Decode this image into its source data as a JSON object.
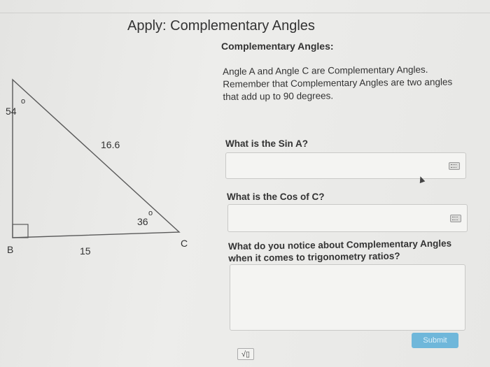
{
  "page": {
    "title": "Apply: Complementary Angles"
  },
  "diagram": {
    "vertex_b": "B",
    "vertex_c": "C",
    "angle_a": "54",
    "angle_c": "36",
    "side_ab_label": "15",
    "side_hyp_label": "16.6",
    "degree_symbol": "o"
  },
  "content": {
    "heading": "Complementary Angles:",
    "intro": "Angle A and Angle C are Complementary Angles. Remember that Complementary Angles are two angles that add up to 90 degrees."
  },
  "questions": [
    {
      "label": "What is the Sin A?",
      "value": ""
    },
    {
      "label": "What is the Cos of C?",
      "value": ""
    },
    {
      "label": "What do you notice about Complementary Angles when it comes to trigonometry ratios?",
      "value": ""
    }
  ],
  "buttons": {
    "submit_label": "Submit",
    "sqrt_label": "√▯"
  },
  "icons": {
    "keyboard": "keyboard-icon",
    "cursor": "mouse-cursor-icon",
    "sqrt": "square-root-icon"
  }
}
